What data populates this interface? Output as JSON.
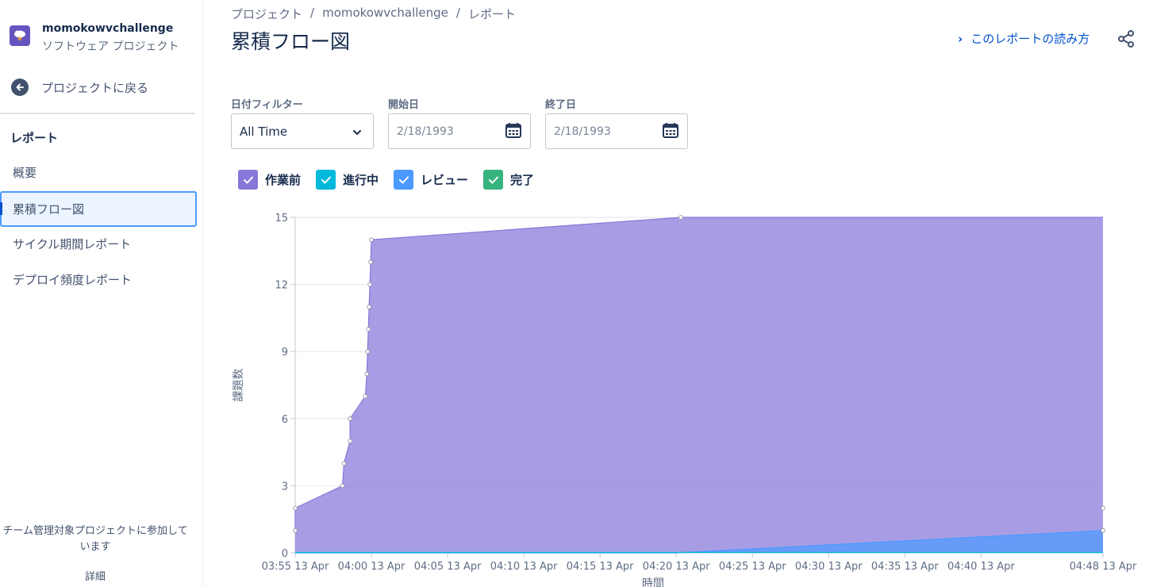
{
  "sidebar": {
    "project_name": "momokowvchallenge",
    "project_type": "ソフトウェア プロジェクト",
    "project_icon": "cloud-lightning-icon",
    "back_label": "プロジェクトに戻る",
    "section_title": "レポート",
    "items": [
      {
        "label": "概要"
      },
      {
        "label": "累積フロー図",
        "active": true
      },
      {
        "label": "サイクル期間レポート"
      },
      {
        "label": "デプロイ頻度レポート"
      }
    ],
    "footer_text": "チーム管理対象プロジェクトに参加しています",
    "detail_label": "詳細"
  },
  "header": {
    "breadcrumb": [
      "プロジェクト",
      "momokowvchallenge",
      "レポート"
    ],
    "title": "累積フロー図",
    "howto_label": "このレポートの読み方"
  },
  "filters": {
    "date_filter_label": "日付フィルター",
    "date_filter_value": "All Time",
    "start_label": "開始日",
    "start_value": "2/18/1993",
    "end_label": "終了日",
    "end_value": "2/18/1993"
  },
  "legend": [
    {
      "label": "作業前",
      "color": "#8777d9",
      "checked": true
    },
    {
      "label": "進行中",
      "color": "#00b8d9",
      "checked": true
    },
    {
      "label": "レビュー",
      "color": "#4c9aff",
      "checked": true
    },
    {
      "label": "完了",
      "color": "#36b37e",
      "checked": true
    }
  ],
  "chart_data": {
    "type": "area",
    "stacked": true,
    "xlabel": "時間",
    "ylabel": "課題数",
    "ylim": [
      0,
      15
    ],
    "yticks": [
      0,
      3,
      6,
      9,
      12,
      15
    ],
    "xlim_minutes": [
      0,
      53
    ],
    "xticks": [
      {
        "t": 0,
        "label": "03:55 13 Apr"
      },
      {
        "t": 5,
        "label": "04:00 13 Apr"
      },
      {
        "t": 10,
        "label": "04:05 13 Apr"
      },
      {
        "t": 15,
        "label": "04:10 13 Apr"
      },
      {
        "t": 20,
        "label": "04:15 13 Apr"
      },
      {
        "t": 25,
        "label": "04:20 13 Apr"
      },
      {
        "t": 30,
        "label": "04:25 13 Apr"
      },
      {
        "t": 35,
        "label": "04:30 13 Apr"
      },
      {
        "t": 40,
        "label": "04:35 13 Apr"
      },
      {
        "t": 45,
        "label": "04:40 13 Apr"
      },
      {
        "t": 53,
        "label": "04:48 13 Apr"
      }
    ],
    "grid": true,
    "series": [
      {
        "name": "作業前",
        "color": "#8777d9",
        "points": [
          [
            0,
            1
          ],
          [
            0,
            2
          ],
          [
            3.1,
            3
          ],
          [
            3.2,
            4
          ],
          [
            3.6,
            5
          ],
          [
            3.6,
            6
          ],
          [
            4.6,
            7
          ],
          [
            4.7,
            8
          ],
          [
            4.75,
            9
          ],
          [
            4.8,
            10
          ],
          [
            4.85,
            11
          ],
          [
            4.9,
            12
          ],
          [
            4.95,
            13
          ],
          [
            5.0,
            14
          ],
          [
            25.3,
            15
          ],
          [
            53,
            15
          ]
        ]
      },
      {
        "name": "レビュー",
        "color": "#4c9aff",
        "points": [
          [
            0,
            0
          ],
          [
            24.9,
            0
          ],
          [
            53,
            1
          ]
        ]
      }
    ],
    "point_markers": [
      [
        0,
        1
      ],
      [
        0,
        2
      ],
      [
        3.1,
        3
      ],
      [
        3.2,
        4
      ],
      [
        3.6,
        5
      ],
      [
        3.6,
        6
      ],
      [
        4.6,
        7
      ],
      [
        4.7,
        8
      ],
      [
        4.75,
        9
      ],
      [
        4.8,
        10
      ],
      [
        4.85,
        11
      ],
      [
        4.9,
        12
      ],
      [
        4.95,
        13
      ],
      [
        5.0,
        14
      ],
      [
        25.3,
        15
      ],
      [
        53,
        1
      ],
      [
        53,
        2
      ]
    ]
  }
}
